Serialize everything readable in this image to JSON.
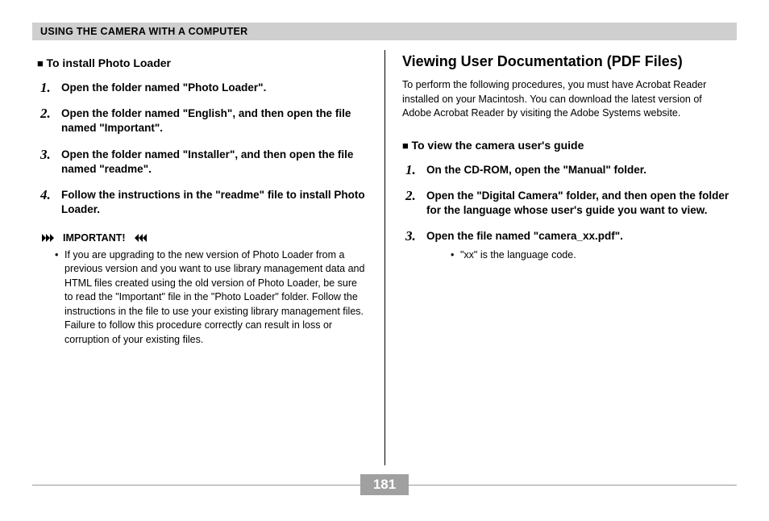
{
  "header": "USING THE CAMERA WITH A COMPUTER",
  "left": {
    "subheading": "To install Photo Loader",
    "steps": [
      "Open the folder named \"Photo Loader\".",
      "Open the folder named \"English\", and then open the file named \"Important\".",
      "Open the folder named \"Installer\", and then open the file named \"readme\".",
      "Follow the instructions in the \"readme\" file to install Photo Loader."
    ],
    "important_label": "IMPORTANT!",
    "important_bullets": [
      "If you are upgrading to the new version of Photo Loader from a previous version and you want to use library management data and HTML files created using the old version of Photo Loader, be sure to read the \"Important\" file in the \"Photo Loader\" folder. Follow the instructions in the file to use your existing library management files. Failure to follow this procedure correctly can result in loss or corruption of your existing files."
    ]
  },
  "right": {
    "heading": "Viewing User Documentation (PDF Files)",
    "intro": "To perform the following procedures, you must have Acrobat Reader installed on your Macintosh. You can download the latest version of Adobe Acrobat Reader by visiting the Adobe Systems website.",
    "subheading": "To view the camera user's guide",
    "steps": [
      "On the CD-ROM, open the \"Manual\" folder.",
      "Open the  \"Digital Camera\" folder, and then open the folder for the language whose user's guide you want to view.",
      "Open the file named \"camera_xx.pdf\"."
    ],
    "note_bullets": [
      "\"xx\" is the language code."
    ]
  },
  "page_number": "181"
}
